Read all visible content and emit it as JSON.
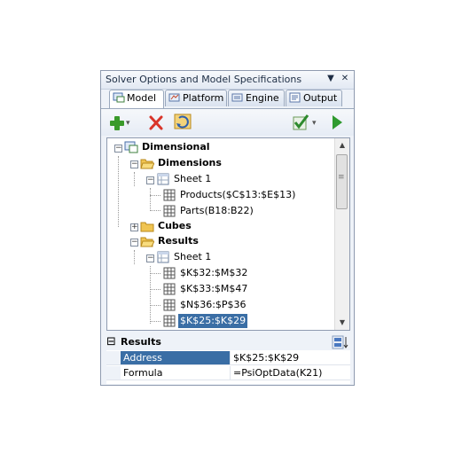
{
  "panel": {
    "title": "Solver Options and Model Specifications",
    "menu_glyph": "▼",
    "close_glyph": "✕"
  },
  "tabs": [
    {
      "label": "Model",
      "icon": "model-icon"
    },
    {
      "label": "Platform",
      "icon": "platform-icon"
    },
    {
      "label": "Engine",
      "icon": "engine-icon"
    },
    {
      "label": "Output",
      "icon": "output-icon"
    }
  ],
  "toolbar": {
    "add_icon": "plus-icon",
    "delete_icon": "x-icon",
    "refresh_icon": "refresh-icon",
    "check_icon": "check-icon",
    "solve_icon": "play-icon",
    "dropdown_glyph": "▾",
    "add_color": "#3a9a2a",
    "delete_color": "#d9352a",
    "solve_color": "#2f9a2f"
  },
  "tree": {
    "root": "Dimensional",
    "dimensions": "Dimensions",
    "dim_sheet": "Sheet 1",
    "dim_products": "Products($C$13:$E$13)",
    "dim_parts": "Parts(B18:B22)",
    "cubes": "Cubes",
    "results": "Results",
    "res_sheet": "Sheet 1",
    "res_1": "$K$32:$M$32",
    "res_2": "$K$33:$M$47",
    "res_3": "$N$36:$P$36",
    "res_4": "$K$25:$K$29",
    "expand_minus": "−",
    "expand_plus": "+",
    "selection_color": "#3a6ea5"
  },
  "scrollbar": {
    "up_glyph": "▲",
    "down_glyph": "▼",
    "grip_glyph": "≡"
  },
  "properties": {
    "section_title": "Results",
    "collapse_glyph": "⊟",
    "rows": [
      {
        "name": "Address",
        "value": "$K$25:$K$29",
        "selected": true
      },
      {
        "name": "Formula",
        "value": "=PsiOptData(K21)",
        "selected": false
      }
    ]
  }
}
